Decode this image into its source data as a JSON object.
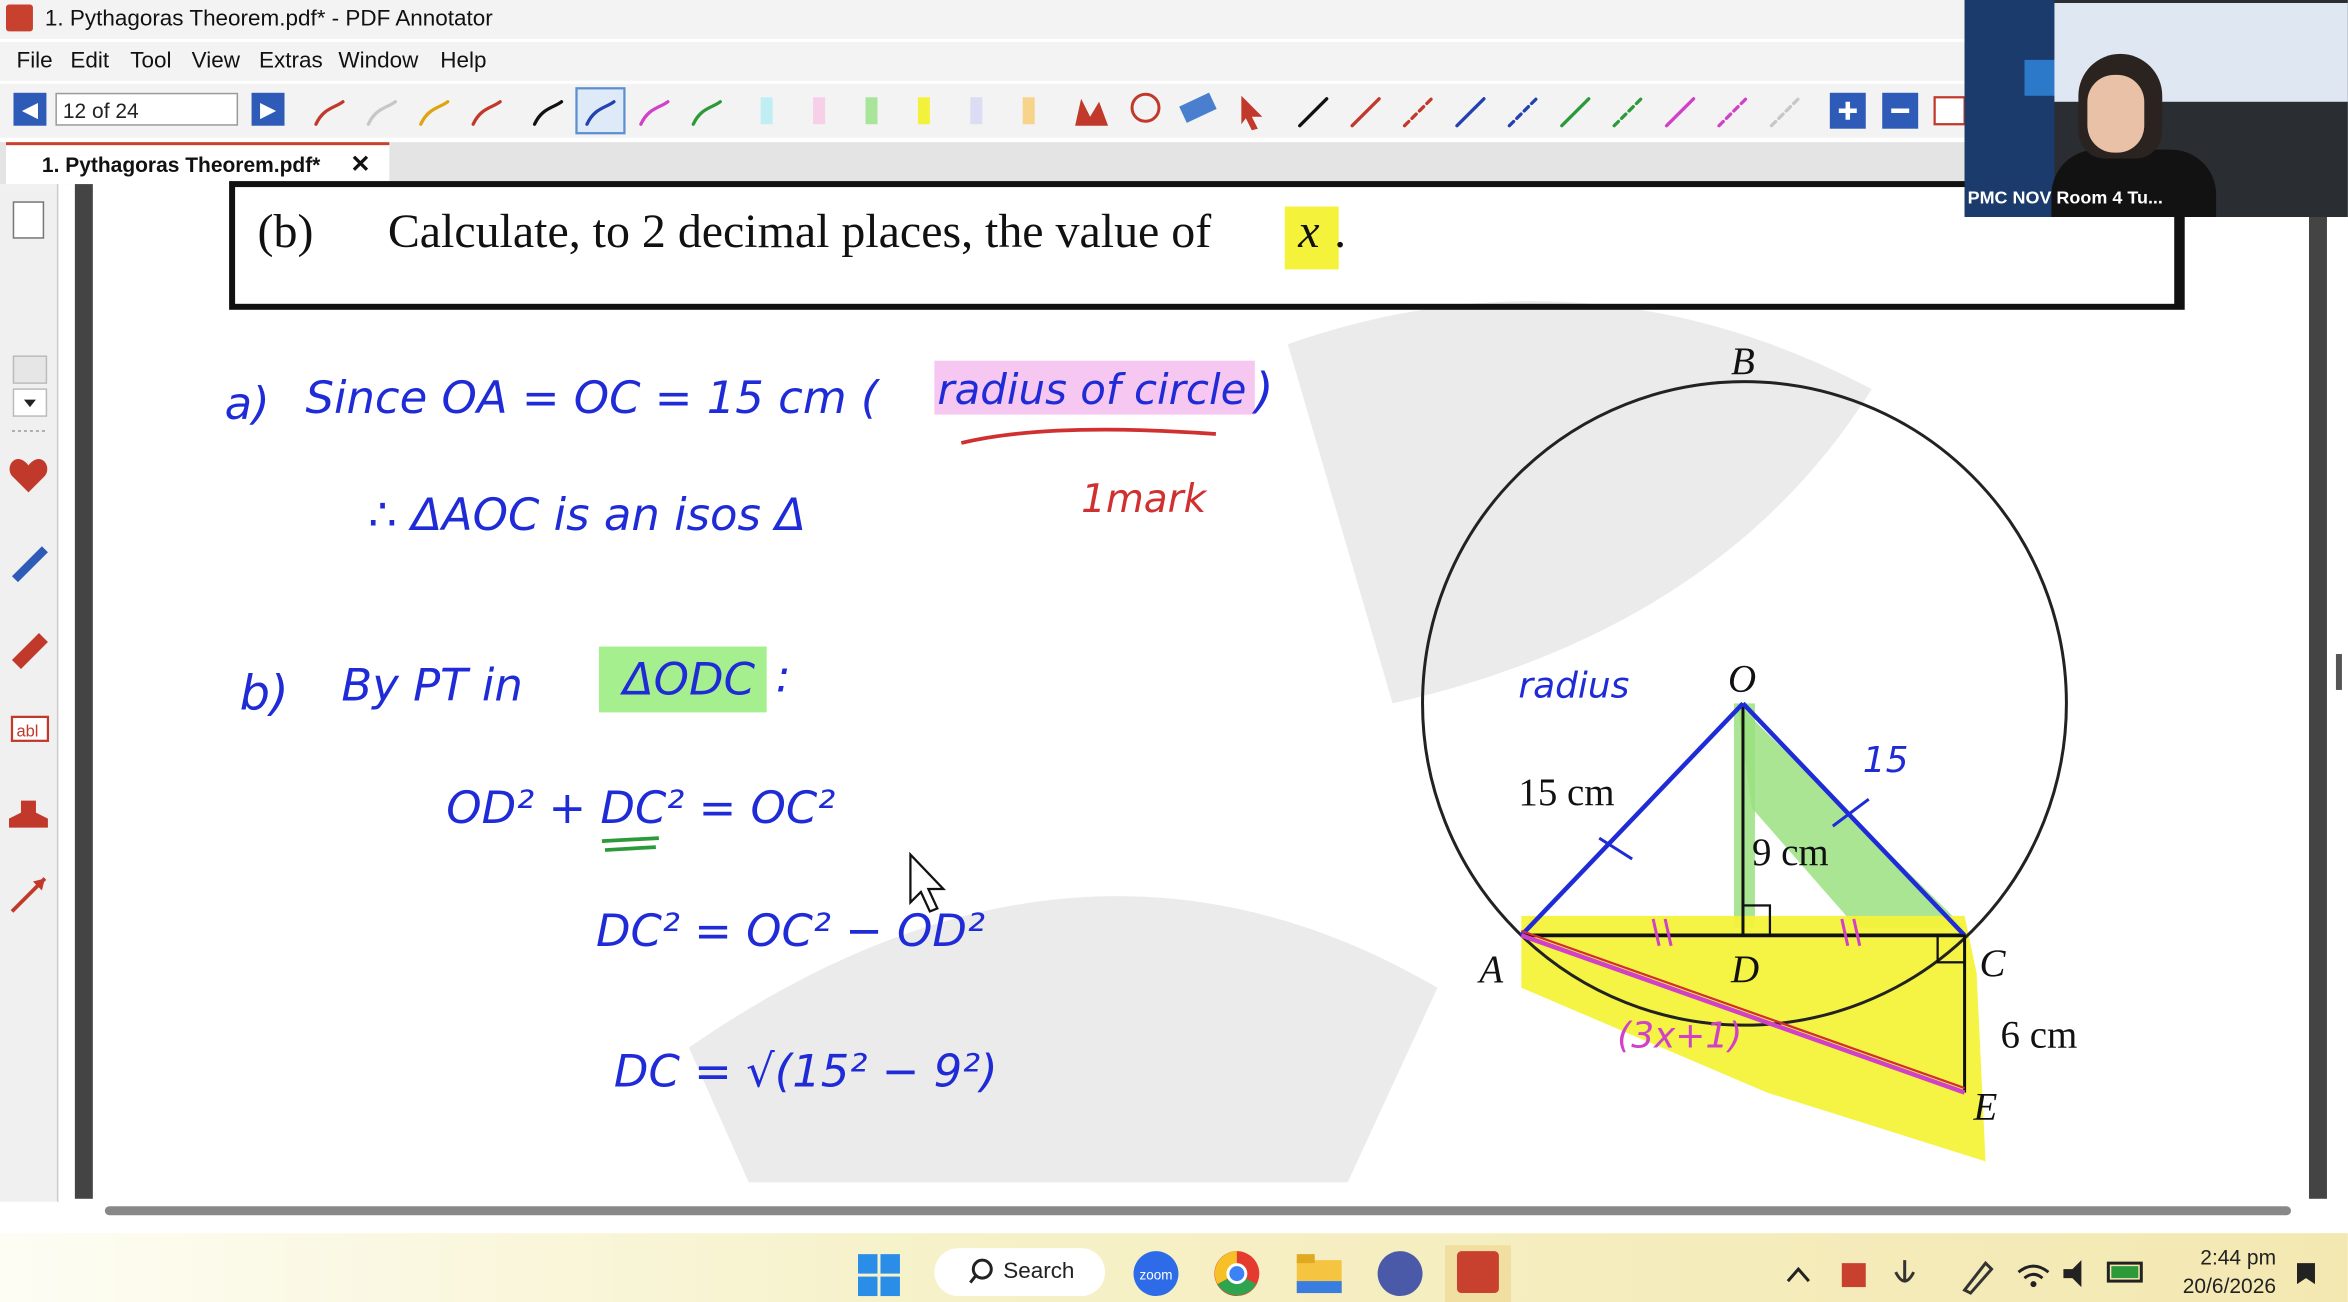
{
  "window": {
    "title": "1. Pythagoras Theorem.pdf* - PDF Annotator"
  },
  "menu": [
    "File",
    "Edit",
    "Tool",
    "View",
    "Extras",
    "Window",
    "Help"
  ],
  "toolbar": {
    "page_indicator": "12 of 24"
  },
  "tab": {
    "label": "1. Pythagoras Theorem.pdf*",
    "close": "✕"
  },
  "document": {
    "question_label": "(b)",
    "question_text": "Calculate, to 2 decimal places, the value of",
    "question_var": "x",
    "question_end": ".",
    "handwriting": {
      "a_label": "a)",
      "a_line1": "Since    OA = OC = 15 cm (",
      "a_highlight": "radius of circle",
      "a_close": ")",
      "a_mark": "1mark",
      "a_line2": "∴ ΔAOC is an isos Δ",
      "b_label": "b)",
      "b_intro": "By PT in",
      "b_highlight": "ΔODC",
      "b_colon": ":",
      "eq1": "OD² + DC² = OC²",
      "eq2": "DC² = OC² − OD²",
      "eq3": "DC = √(15² − 9²)",
      "radius_note": "radius",
      "fifteen_note": "15",
      "expr_note": "(3x+1)"
    },
    "diagram": {
      "B": "B",
      "O": "O",
      "A": "A",
      "C": "C",
      "D": "D",
      "E": "E",
      "len_OA": "15 cm",
      "len_OD": "9 cm",
      "len_CE": "6 cm"
    }
  },
  "webcam": {
    "name": "PMC NOV Room 4 Tu..."
  },
  "taskbar": {
    "search": "Search",
    "time": "2:44 pm",
    "date": "20/6/2026",
    "zoom": "zoom"
  }
}
